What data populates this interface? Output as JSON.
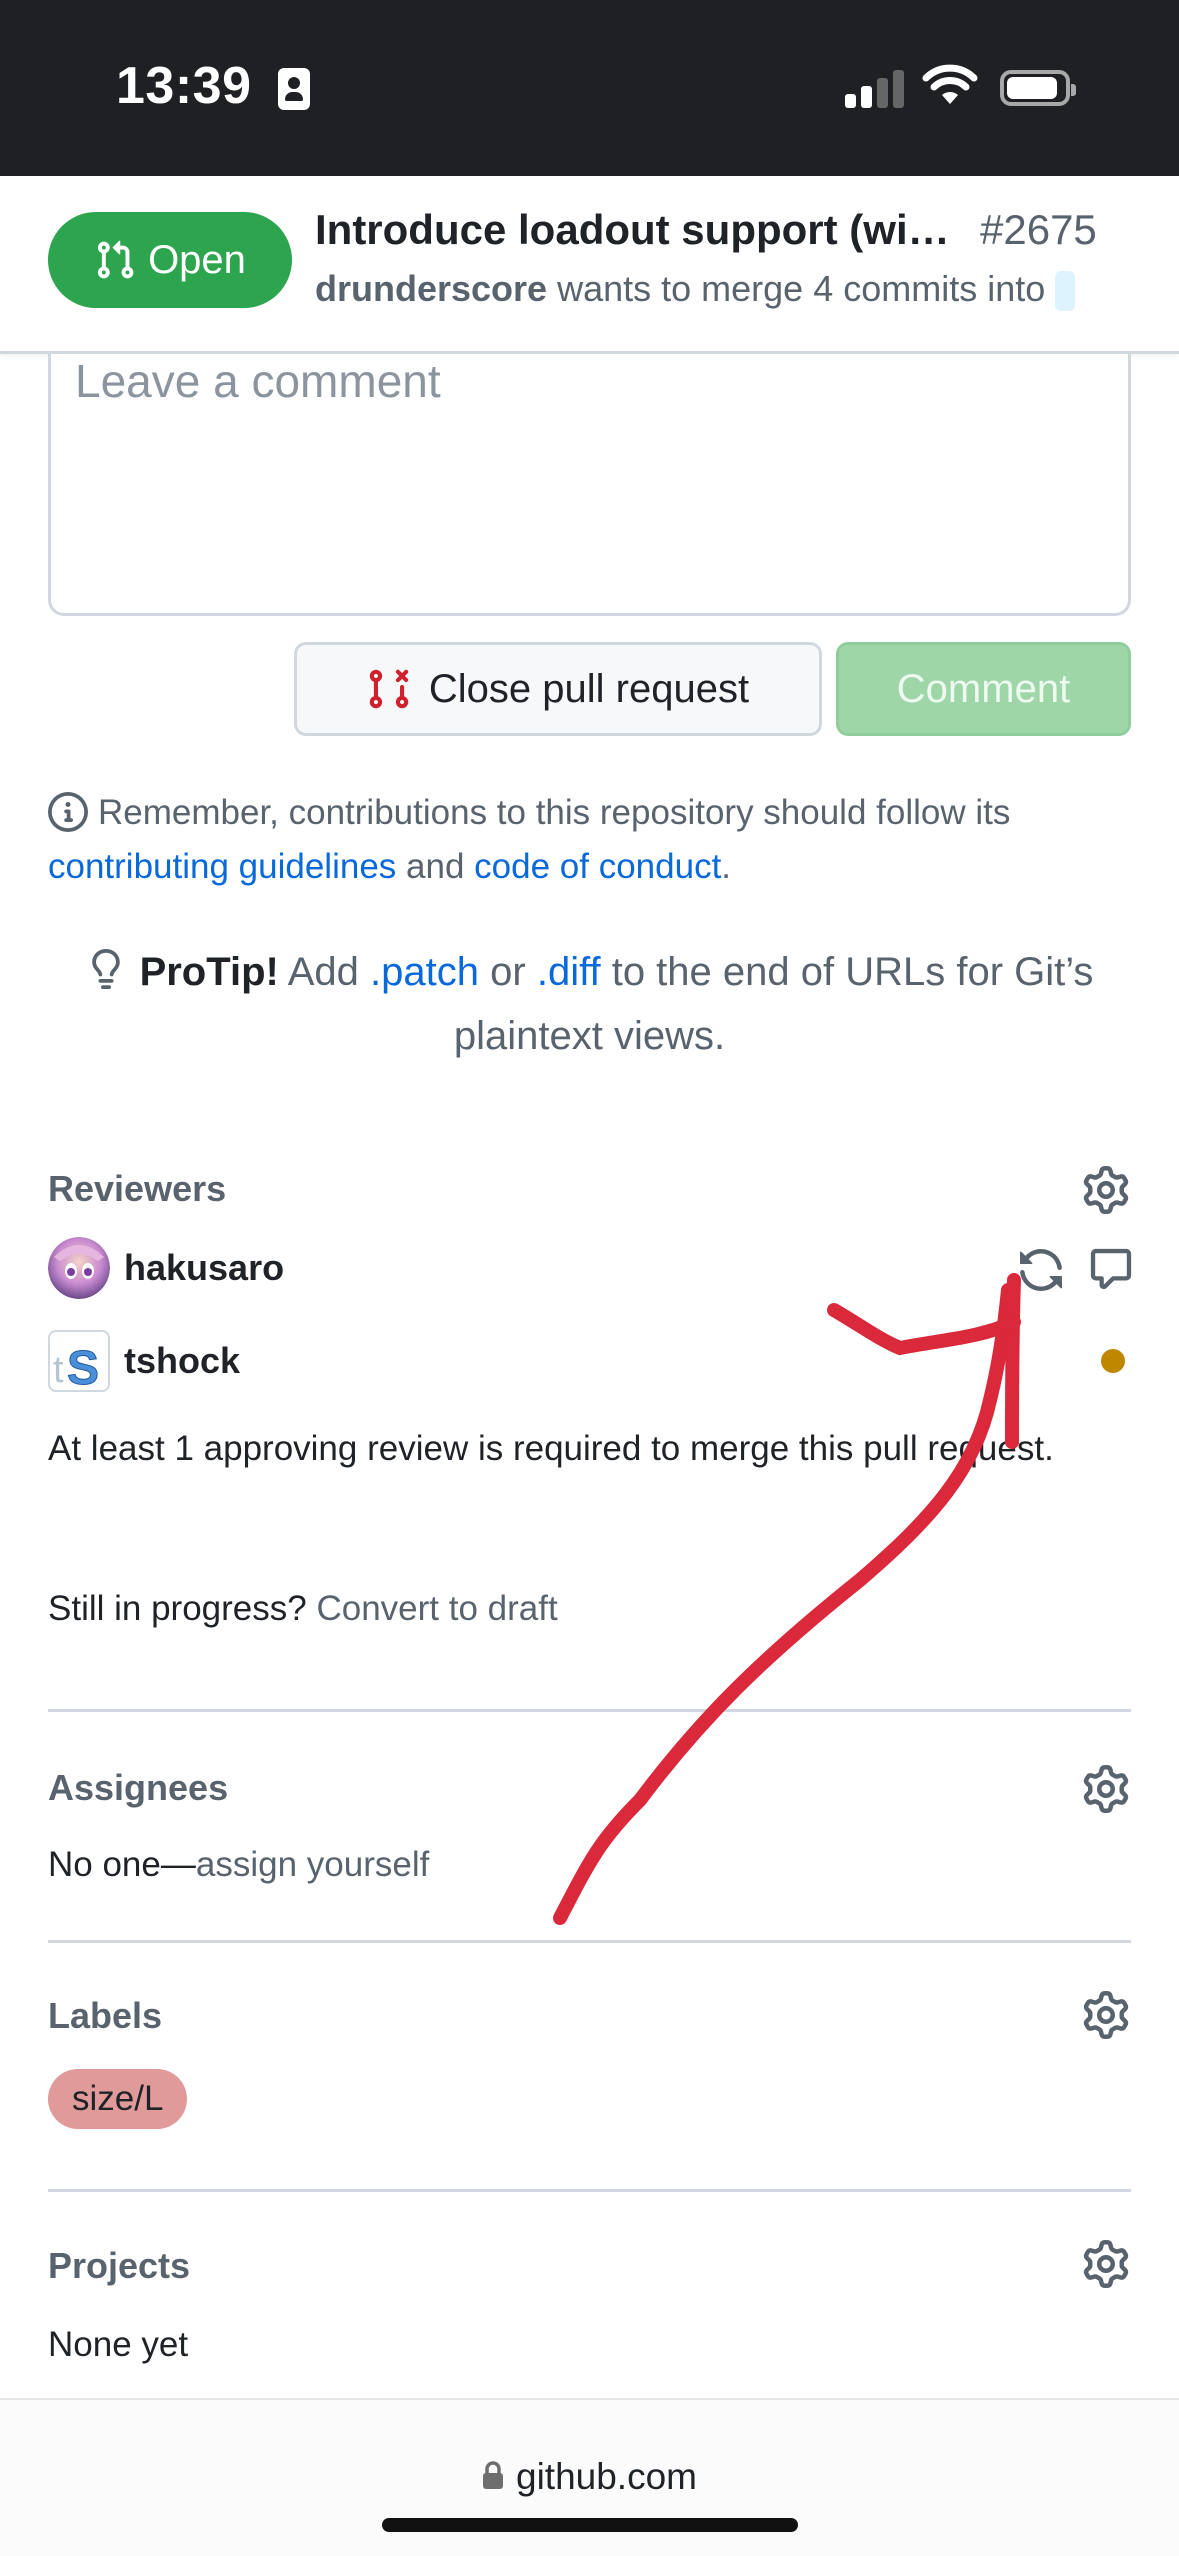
{
  "status_bar": {
    "time": "13:39",
    "icons": [
      "contact-card-icon",
      "cellular-signal-icon",
      "wifi-icon",
      "battery-icon"
    ]
  },
  "pr_header": {
    "state": "Open",
    "title": "Introduce loadout support (wi…",
    "number": "#2675",
    "author": "drunderscore",
    "merge_text": "wants to merge 4 commits into"
  },
  "comment": {
    "placeholder": "Leave a comment",
    "close_button": "Close pull request",
    "comment_button": "Comment"
  },
  "remember": {
    "text": "Remember, contributions to this repository should follow its",
    "guidelines_link": "contributing guidelines",
    "and": "and",
    "conduct_link": "code of conduct",
    "period": "."
  },
  "protip": {
    "label": "ProTip!",
    "text1": "Add",
    "patch": ".patch",
    "or": "or",
    "diff": ".diff",
    "text2": "to the end of URLs for Git’s plaintext views."
  },
  "reviewers": {
    "heading": "Reviewers",
    "items": [
      {
        "name": "hakusaro",
        "status": "re-request",
        "actions": [
          "sync-icon",
          "comment-icon"
        ]
      },
      {
        "name": "tshock",
        "status": "pending",
        "status_color": "#bf8700"
      }
    ],
    "requirement": "At least 1 approving review is required to merge this pull request.",
    "draft_prompt": "Still in progress?",
    "draft_link": "Convert to draft"
  },
  "assignees": {
    "heading": "Assignees",
    "none": "No one—",
    "assign_link": "assign yourself"
  },
  "labels": {
    "heading": "Labels",
    "items": [
      {
        "name": "size/L",
        "color": "#e09a9a"
      }
    ]
  },
  "projects": {
    "heading": "Projects",
    "value": "None yet"
  },
  "browser": {
    "url": "github.com"
  },
  "colors": {
    "open_green": "#2da44e",
    "link_blue": "#0969da",
    "annotation_red": "#d9293a"
  }
}
